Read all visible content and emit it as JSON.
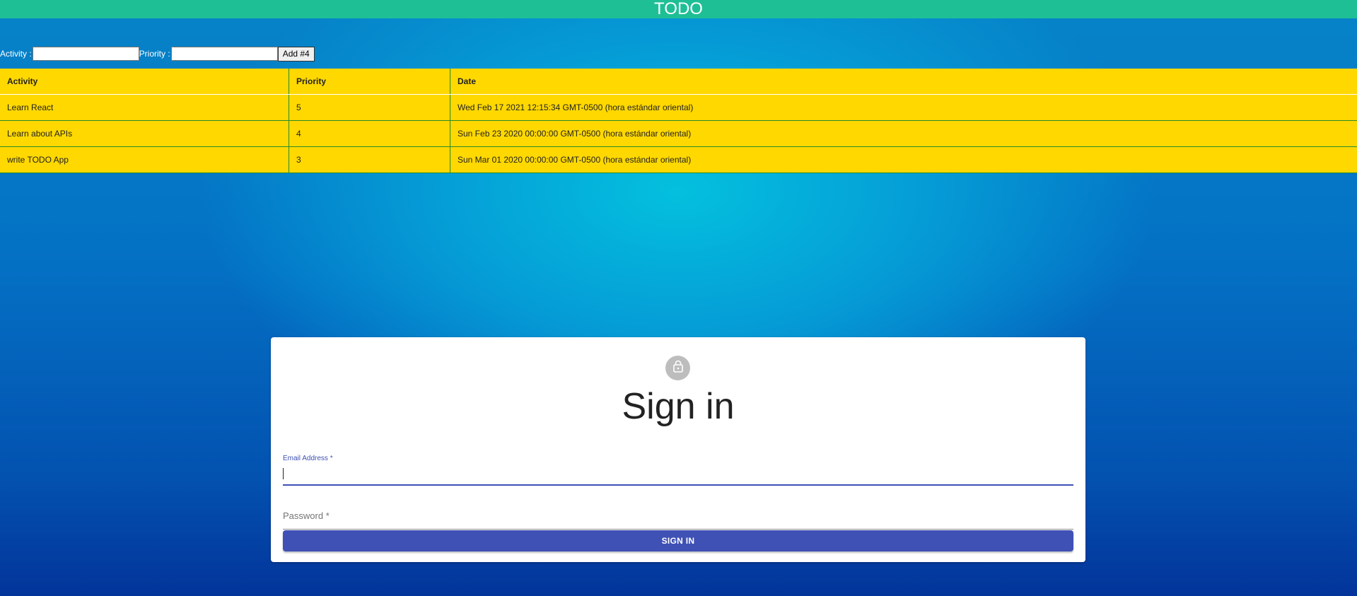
{
  "header": {
    "title": "TODO"
  },
  "form": {
    "activity_label": "Activity :",
    "activity_value": "",
    "priority_label": "Priority :",
    "priority_value": "",
    "add_button_label": "Add #4"
  },
  "table": {
    "headers": [
      "Activity",
      "Priority",
      "Date"
    ],
    "rows": [
      {
        "activity": "Learn React",
        "priority": "5",
        "date": "Wed Feb 17 2021 12:15:34 GMT-0500 (hora estándar oriental)"
      },
      {
        "activity": "Learn about APIs",
        "priority": "4",
        "date": "Sun Feb 23 2020 00:00:00 GMT-0500 (hora estándar oriental)"
      },
      {
        "activity": "write TODO App",
        "priority": "3",
        "date": "Sun Mar 01 2020 00:00:00 GMT-0500 (hora estándar oriental)"
      }
    ]
  },
  "signin": {
    "icon": "lock-icon",
    "title": "Sign in",
    "email_label": "Email Address *",
    "email_value": "",
    "password_label": "Password *",
    "password_value": "",
    "button_label": "SIGN IN"
  },
  "colors": {
    "header_bar": "#1fbf96",
    "table_background": "#ffd800",
    "primary": "#3f51b5",
    "avatar": "#bdbdbd"
  }
}
